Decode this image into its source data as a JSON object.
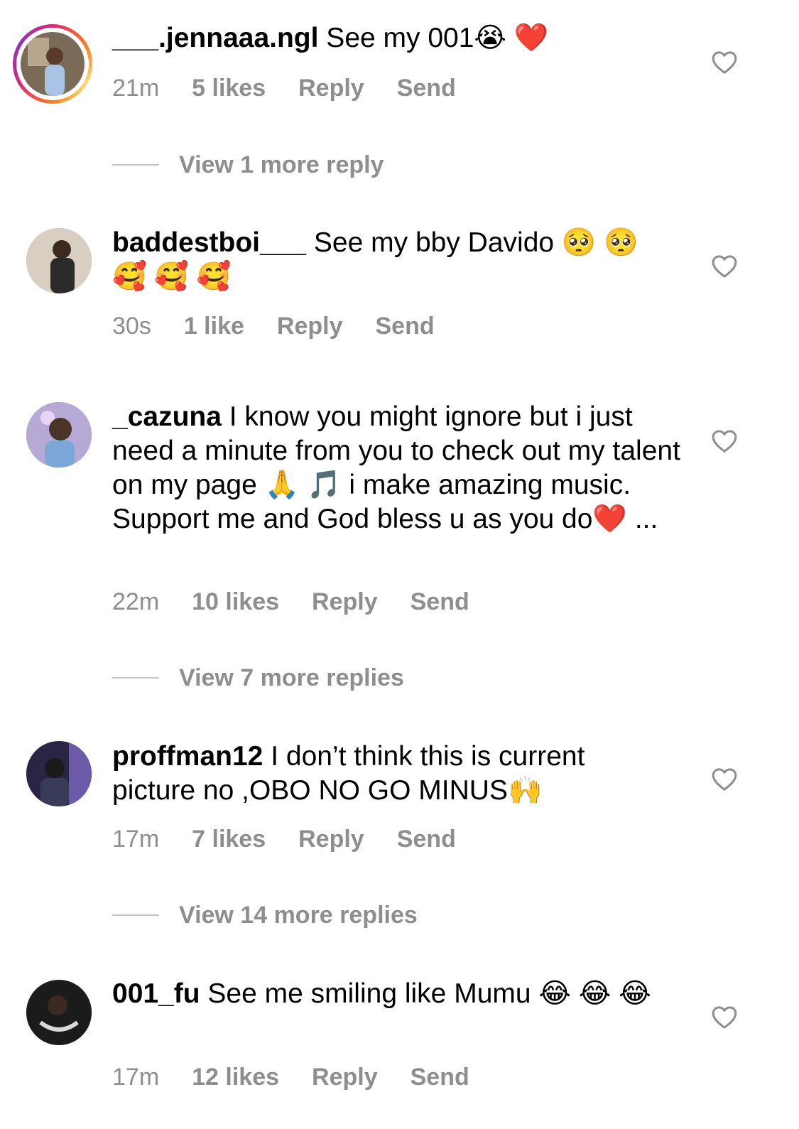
{
  "comments": [
    {
      "username": "___.jennaaa.ngl",
      "text": " See my 001😭 ❤️",
      "time": "21m",
      "likes": "5 likes",
      "reply": "Reply",
      "send": "Send",
      "has_story_ring": true
    },
    {
      "username": "baddestboi___",
      "text": " See my bby Davido 🥺 🥺 🥰 🥰 🥰",
      "time": "30s",
      "likes": "1 like",
      "reply": "Reply",
      "send": "Send"
    },
    {
      "username": "_cazuna",
      "text": " I know you might ignore but i just need a minute from you to check out my talent on my page 🙏 🎵 i make amazing music. Support me and God bless u as you do❤️ ...",
      "time": "22m",
      "likes": "10 likes",
      "reply": "Reply",
      "send": "Send"
    },
    {
      "username": "proffman12",
      "text": " I don’t think this is current picture no ,OBO NO GO MINUS🙌",
      "time": "17m",
      "likes": "7 likes",
      "reply": "Reply",
      "send": "Send"
    },
    {
      "username": "001_fu",
      "text": " See me smiling like Mumu 😂 😂 😂",
      "time": "17m",
      "likes": "12 likes",
      "reply": "Reply",
      "send": "Send"
    }
  ],
  "view_more": [
    "View 1 more reply",
    "View 7 more replies",
    "View 14 more replies"
  ],
  "colors": {
    "secondary_text": "#8e8e8e",
    "divider": "#c7c7c7",
    "heart_stroke": "#8e8e8e"
  },
  "icons": {
    "like": "heart-outline-icon"
  }
}
